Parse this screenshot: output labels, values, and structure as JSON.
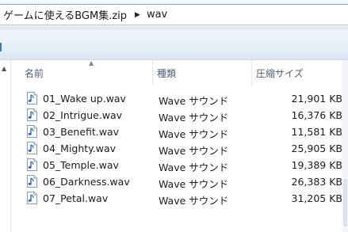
{
  "address": {
    "crumbs": [
      "ゲームに使えるBGM集.zip",
      "wav"
    ]
  },
  "columns": {
    "name": "名前",
    "type": "種類",
    "size": "圧縮サイズ",
    "sorted_by": "name"
  },
  "files": [
    {
      "name": "01_Wake up.wav",
      "type": "Wave サウンド",
      "size": "21,901 KB"
    },
    {
      "name": "02_Intrigue.wav",
      "type": "Wave サウンド",
      "size": "16,376 KB"
    },
    {
      "name": "03_Benefit.wav",
      "type": "Wave サウンド",
      "size": "11,581 KB"
    },
    {
      "name": "04_Mighty.wav",
      "type": "Wave サウンド",
      "size": "25,905 KB"
    },
    {
      "name": "05_Temple.wav",
      "type": "Wave サウンド",
      "size": "19,389 KB"
    },
    {
      "name": "06_Darkness.wav",
      "type": "Wave サウンド",
      "size": "26,383 KB"
    },
    {
      "name": "07_Petal.wav",
      "type": "Wave サウンド",
      "size": "31,205 KB"
    }
  ],
  "icons": {
    "file": "audio-file-icon",
    "breadcrumb_separator": "chevron-right-icon",
    "sort": "sort-ascending-icon"
  },
  "colors": {
    "header_text": "#4c607a",
    "audio_icon": "#2f6db8"
  }
}
